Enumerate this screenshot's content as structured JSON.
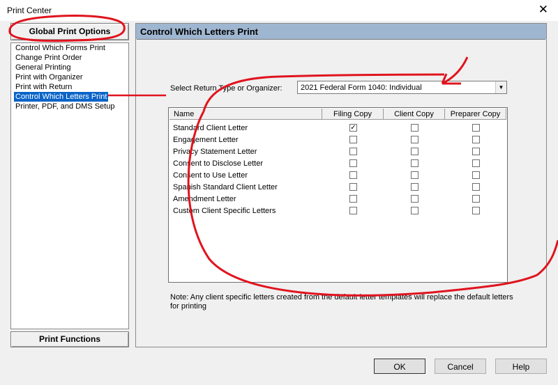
{
  "window": {
    "title": "Print Center",
    "close_glyph": "✕"
  },
  "left": {
    "global_button": "Global Print Options",
    "items": [
      "Control Which Forms Print",
      "Change Print Order",
      "General Printing",
      "Print with Organizer",
      "Print with Return",
      "Control Which Letters Print",
      "Printer, PDF, and DMS Setup"
    ],
    "selected_item": "Control Which Letters Print",
    "functions_button": "Print Functions"
  },
  "panel": {
    "header": "Control Which Letters Print",
    "select_label": "Select Return Type or Organizer:",
    "select_value": "2021 Federal Form 1040: Individual",
    "columns": [
      "Name",
      "Filing Copy",
      "Client Copy",
      "Preparer Copy"
    ],
    "rows": [
      {
        "name": "Standard Client Letter",
        "filing": true,
        "client": false,
        "preparer": false
      },
      {
        "name": "Engagement Letter",
        "filing": false,
        "client": false,
        "preparer": false
      },
      {
        "name": "Privacy Statement Letter",
        "filing": false,
        "client": false,
        "preparer": false
      },
      {
        "name": "Consent to Disclose Letter",
        "filing": false,
        "client": false,
        "preparer": false
      },
      {
        "name": "Consent to Use Letter",
        "filing": false,
        "client": false,
        "preparer": false
      },
      {
        "name": "Spanish Standard Client Letter",
        "filing": false,
        "client": false,
        "preparer": false
      },
      {
        "name": "Amendment Letter",
        "filing": false,
        "client": false,
        "preparer": false
      },
      {
        "name": "Custom Client Specific Letters",
        "filing": false,
        "client": false,
        "preparer": false
      }
    ],
    "note": "Note: Any client specific letters created from the default letter templates will replace the default letters for printing"
  },
  "footer": {
    "ok": "OK",
    "cancel": "Cancel",
    "help": "Help"
  },
  "colors": {
    "header_bg": "#9fb6d1",
    "selection_bg": "#0a64c8",
    "annotation_red": "#e0141e"
  }
}
